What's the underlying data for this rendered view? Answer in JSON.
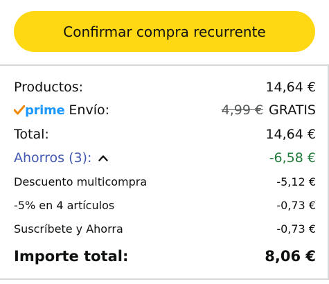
{
  "confirm_button": {
    "label": "Confirmar compra recurrente"
  },
  "summary": {
    "products": {
      "label": "Productos:",
      "value": "14,64 €"
    },
    "shipping": {
      "brand": "prime",
      "label": "Envío:",
      "original_price": "4,99 €",
      "value": "GRATIS"
    },
    "total": {
      "label": "Total:",
      "value": "14,64 €"
    },
    "savings": {
      "label": "Ahorros (3):",
      "value": "-6,58 €",
      "icon": "chevron-up-icon"
    },
    "discounts": [
      {
        "label": "Descuento multicompra",
        "value": "-5,12 €"
      },
      {
        "label": "-5% en 4 artículos",
        "value": "-0,73 €"
      },
      {
        "label": "Suscríbete y Ahorra",
        "value": "-0,73 €"
      }
    ],
    "grand_total": {
      "label": "Importe total:",
      "value": "8,06 €"
    }
  },
  "colors": {
    "button": "#ffd814",
    "link": "#4257b2",
    "savings": "#1e7b3a",
    "prime_blue": "#1a98ff",
    "prime_check": "#f08804"
  }
}
